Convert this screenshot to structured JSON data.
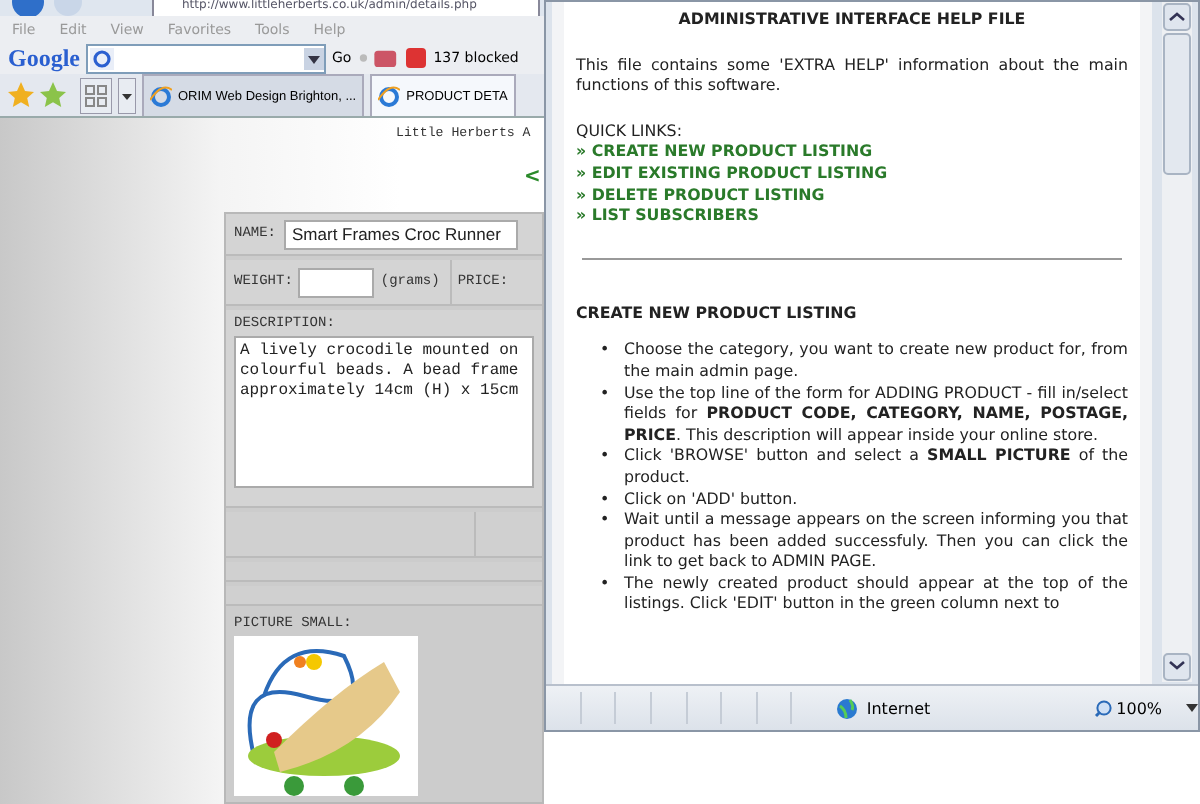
{
  "browser": {
    "address": "http://www.littleherberts.co.uk/admin/details.php",
    "menu": [
      "File",
      "Edit",
      "View",
      "Favorites",
      "Tools",
      "Help"
    ],
    "google_toolbar": {
      "logo": "Google",
      "go": "Go",
      "blocked": "137 blocked"
    },
    "tabs": [
      {
        "label": "ORIM Web Design Brighton, ...",
        "selected": false
      },
      {
        "label": "PRODUCT DETA",
        "selected": true
      }
    ],
    "page": {
      "site_title": "Little Herberts A",
      "back_link": "<",
      "form": {
        "name_label": "NAME:",
        "name_value": "Smart Frames Croc Runner",
        "weight_label": "WEIGHT:",
        "weight_unit": "(grams)",
        "price_label": "PRICE:",
        "description_label": "DESCRIPTION:",
        "description_lines": [
          "A lively crocodile mounted on",
          "colourful beads. A bead frame",
          "approximately 14cm (H) x 15cm"
        ],
        "picture_label": "PICTURE SMALL:"
      }
    }
  },
  "help_window": {
    "title": "ADMINISTRATIVE INTERFACE HELP FILE",
    "intro": "This file contains some 'EXTRA HELP' information about the main functions of this software.",
    "quick_links_label": "QUICK LINKS:",
    "quick_links": [
      "» CREATE NEW PRODUCT LISTING",
      "» EDIT EXISTING PRODUCT LISTING",
      "» DELETE PRODUCT LISTING",
      "» LIST SUBSCRIBERS"
    ],
    "section_title": "CREATE NEW PRODUCT LISTING",
    "steps": [
      {
        "marker": "•",
        "text": "Choose the category, you want to create new product for, from the main admin page."
      },
      {
        "marker": "•",
        "text": "Use the top line of the form for ADDING PRODUCT - fill in/select fields for **PRODUCT CODE, CATEGORY, NAME, POSTAGE, PRICE**. This description will appear inside your online store."
      },
      {
        "marker": "•",
        "text": "Click 'BROWSE' button and select a **SMALL PICTURE** of the product."
      },
      {
        "marker": "•",
        "text": "Click on 'ADD' button."
      },
      {
        "marker": "•",
        "text": "Wait until a message appears on the screen informing you that product has been added successfuly. Then you can click the link to get back to ADMIN PAGE."
      },
      {
        "marker": "•",
        "text": "The newly created product should appear at the top of the listings. Click 'EDIT' button in the green column next to"
      }
    ],
    "status": {
      "zone": "Internet",
      "zoom": "100%"
    }
  }
}
